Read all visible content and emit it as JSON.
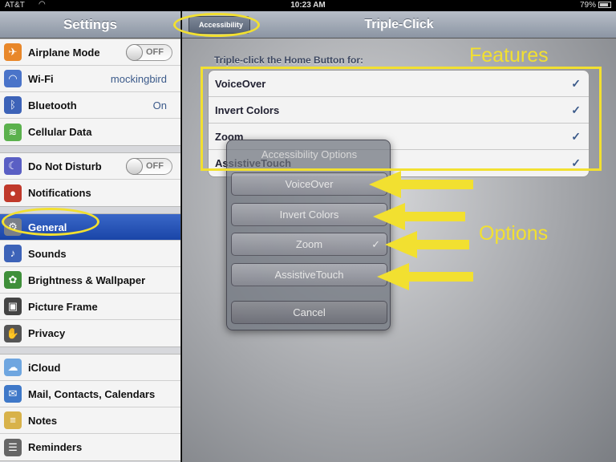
{
  "status_bar": {
    "carrier": "AT&T",
    "time": "10:23 AM",
    "battery": "79%"
  },
  "sidebar": {
    "title": "Settings",
    "groups": [
      [
        {
          "label": "Airplane Mode",
          "icon": "airplane-icon",
          "toggle": "OFF"
        },
        {
          "label": "Wi-Fi",
          "icon": "wifi-icon",
          "value": "mockingbird"
        },
        {
          "label": "Bluetooth",
          "icon": "bluetooth-icon",
          "value": "On"
        },
        {
          "label": "Cellular Data",
          "icon": "cellular-icon"
        }
      ],
      [
        {
          "label": "Do Not Disturb",
          "icon": "moon-icon",
          "toggle": "OFF"
        },
        {
          "label": "Notifications",
          "icon": "notifications-icon"
        }
      ],
      [
        {
          "label": "General",
          "icon": "gear-icon",
          "selected": true
        },
        {
          "label": "Sounds",
          "icon": "speaker-icon"
        },
        {
          "label": "Brightness & Wallpaper",
          "icon": "flower-icon"
        },
        {
          "label": "Picture Frame",
          "icon": "picture-frame-icon"
        },
        {
          "label": "Privacy",
          "icon": "hand-icon"
        }
      ],
      [
        {
          "label": "iCloud",
          "icon": "cloud-icon"
        },
        {
          "label": "Mail, Contacts, Calendars",
          "icon": "mail-icon"
        },
        {
          "label": "Notes",
          "icon": "notes-icon"
        },
        {
          "label": "Reminders",
          "icon": "reminders-icon"
        }
      ]
    ]
  },
  "main": {
    "back_label": "Accessibility",
    "title": "Triple-Click",
    "section_label": "Triple-click the Home Button for:",
    "features": [
      {
        "name": "VoiceOver",
        "check": "✓"
      },
      {
        "name": "Invert Colors",
        "check": "✓"
      },
      {
        "name": "Zoom",
        "check": "✓"
      },
      {
        "name": "AssistiveTouch",
        "check": "✓"
      }
    ]
  },
  "action_sheet": {
    "title": "Accessibility Options",
    "options": [
      {
        "label": "VoiceOver",
        "check": ""
      },
      {
        "label": "Invert Colors",
        "check": ""
      },
      {
        "label": "Zoom",
        "check": "✓"
      },
      {
        "label": "AssistiveTouch",
        "check": ""
      }
    ],
    "cancel": "Cancel"
  },
  "annotations": {
    "features": "Features",
    "options": "Options",
    "color": "#f2e030"
  }
}
